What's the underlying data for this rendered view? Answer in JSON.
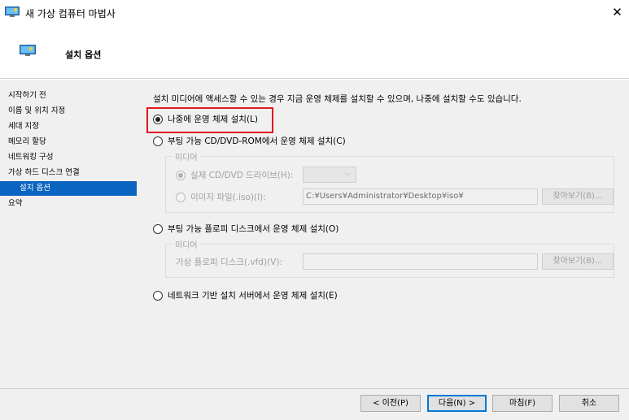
{
  "window": {
    "title": "새 가상 컴퓨터 마법사",
    "close_glyph": "✕"
  },
  "header": {
    "title": "설치 옵션"
  },
  "sidebar": {
    "items": [
      {
        "label": "시작하기 전"
      },
      {
        "label": "이름 및 위치 지정"
      },
      {
        "label": "세대 지정"
      },
      {
        "label": "메모리 할당"
      },
      {
        "label": "네트워킹 구성"
      },
      {
        "label": "가상 하드 디스크 연결"
      },
      {
        "label": "설치 옵션",
        "active": true
      },
      {
        "label": "요약"
      }
    ]
  },
  "main": {
    "description": "설치 미디어에 액세스할 수 있는 경우 지금 운영 체제를 설치할 수 있으며, 나중에 설치할 수도 있습니다.",
    "options": {
      "later": {
        "label": "나중에 운영 체제 설치(L)",
        "selected": true
      },
      "cd": {
        "label": "부팅 가능 CD/DVD-ROM에서 운영 체제 설치(C)",
        "selected": false
      },
      "floppy": {
        "label": "부팅 가능 플로피 디스크에서 운영 체제 설치(O)",
        "selected": false
      },
      "network": {
        "label": "네트워크 기반 설치 서버에서 운영 체제 설치(E)",
        "selected": false
      }
    },
    "cd_group": {
      "legend": "미디어",
      "physical_label": "실제 CD/DVD 드라이브(H):",
      "physical_value": "",
      "image_label": "이미지 파일(.iso)(I):",
      "image_path": "C:¥Users¥Administrator¥Desktop¥iso¥",
      "browse_label": "찾아보기(B)..."
    },
    "floppy_group": {
      "legend": "미디어",
      "vfd_label": "가상 플로피 디스크(.vfd)(V):",
      "vfd_path": "",
      "browse_label": "찾아보기(B)..."
    }
  },
  "footer": {
    "prev_label": "< 이전(P)",
    "next_label": "다음(N) >",
    "finish_label": "마침(F)",
    "cancel_label": "취소"
  },
  "colors": {
    "selection": "#0b64c0",
    "highlight_box": "#e0191f",
    "panel_bg": "#f0f0f0"
  }
}
